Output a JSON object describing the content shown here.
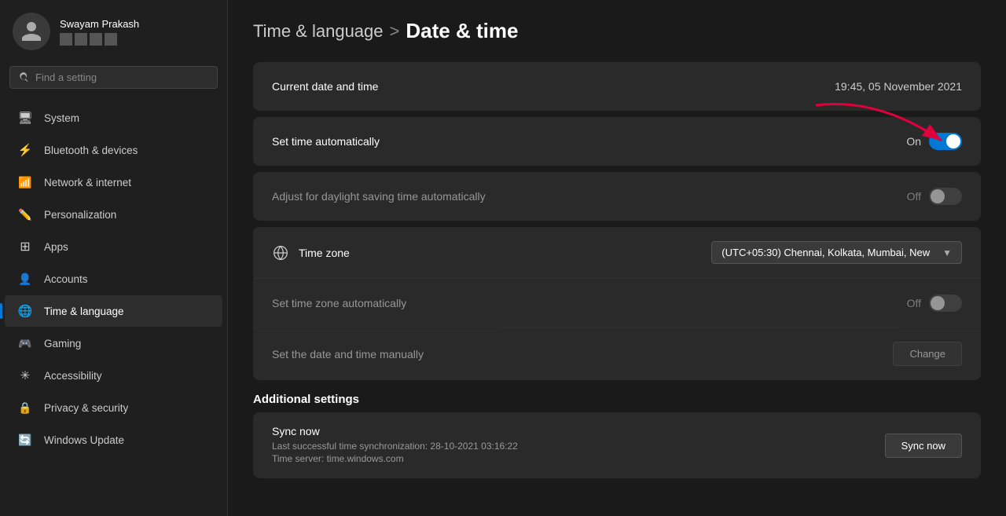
{
  "user": {
    "name": "Swayam Prakash"
  },
  "search": {
    "placeholder": "Find a setting"
  },
  "nav": {
    "items": [
      {
        "id": "system",
        "label": "System",
        "icon": "system"
      },
      {
        "id": "bluetooth",
        "label": "Bluetooth & devices",
        "icon": "bluetooth"
      },
      {
        "id": "network",
        "label": "Network & internet",
        "icon": "network"
      },
      {
        "id": "personalization",
        "label": "Personalization",
        "icon": "personalization"
      },
      {
        "id": "apps",
        "label": "Apps",
        "icon": "apps"
      },
      {
        "id": "accounts",
        "label": "Accounts",
        "icon": "accounts"
      },
      {
        "id": "time",
        "label": "Time & language",
        "icon": "time",
        "active": true
      },
      {
        "id": "gaming",
        "label": "Gaming",
        "icon": "gaming"
      },
      {
        "id": "accessibility",
        "label": "Accessibility",
        "icon": "accessibility"
      },
      {
        "id": "privacy",
        "label": "Privacy & security",
        "icon": "privacy"
      },
      {
        "id": "update",
        "label": "Windows Update",
        "icon": "update"
      }
    ]
  },
  "page": {
    "parent_title": "Time & language",
    "separator": ">",
    "title": "Date & time"
  },
  "settings": {
    "current_date_time_label": "Current date and time",
    "current_date_time_value": "19:45, 05 November 2021",
    "set_time_auto_label": "Set time automatically",
    "set_time_auto_value": "On",
    "set_time_auto_state": "on",
    "adjust_daylight_label": "Adjust for daylight saving time automatically",
    "adjust_daylight_value": "Off",
    "adjust_daylight_state": "off",
    "time_zone_label": "Time zone",
    "time_zone_value": "(UTC+05:30) Chennai, Kolkata, Mumbai, New",
    "set_zone_auto_label": "Set time zone automatically",
    "set_zone_auto_value": "Off",
    "set_zone_auto_state": "off",
    "set_manual_label": "Set the date and time manually",
    "change_btn": "Change",
    "additional_settings_header": "Additional settings",
    "sync_title": "Sync now",
    "sync_sub1": "Last successful time synchronization: 28-10-2021 03:16:22",
    "sync_sub2": "Time server: time.windows.com",
    "sync_now_btn": "Sync now"
  }
}
